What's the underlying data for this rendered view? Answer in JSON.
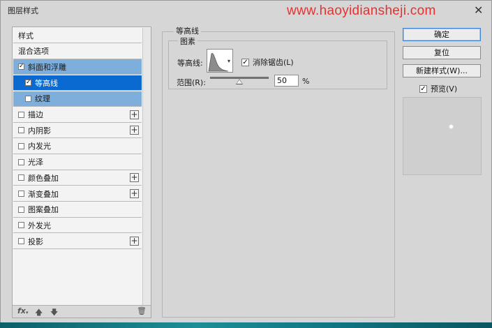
{
  "window": {
    "title": "图层样式",
    "watermark": "www.haoyidiansheji.com"
  },
  "style_list": {
    "items": [
      {
        "label": "样式",
        "checkbox": false,
        "checked": false,
        "plus": false
      },
      {
        "label": "混合选项",
        "checkbox": false,
        "checked": false,
        "plus": false
      },
      {
        "label": "斜面和浮雕",
        "checkbox": true,
        "checked": true,
        "plus": false
      },
      {
        "label": "等高线",
        "checkbox": true,
        "checked": true,
        "plus": false
      },
      {
        "label": "纹理",
        "checkbox": true,
        "checked": false,
        "plus": false
      },
      {
        "label": "描边",
        "checkbox": true,
        "checked": false,
        "plus": true
      },
      {
        "label": "内阴影",
        "checkbox": true,
        "checked": false,
        "plus": true
      },
      {
        "label": "内发光",
        "checkbox": true,
        "checked": false,
        "plus": false
      },
      {
        "label": "光泽",
        "checkbox": true,
        "checked": false,
        "plus": false
      },
      {
        "label": "颜色叠加",
        "checkbox": true,
        "checked": false,
        "plus": true
      },
      {
        "label": "渐变叠加",
        "checkbox": true,
        "checked": false,
        "plus": true
      },
      {
        "label": "图案叠加",
        "checkbox": true,
        "checked": false,
        "plus": false
      },
      {
        "label": "外发光",
        "checkbox": true,
        "checked": false,
        "plus": false
      },
      {
        "label": "投影",
        "checkbox": true,
        "checked": false,
        "plus": true
      }
    ],
    "footer": {
      "fx": "fx"
    }
  },
  "contour_panel": {
    "group_title": "等高线",
    "sub_title": "图素",
    "contour_label": "等高线:",
    "anti_alias_label": "消除锯齿(L)",
    "anti_alias_checked": true,
    "range_label": "范围(R):",
    "range_value": "50",
    "range_unit": "%"
  },
  "buttons": {
    "ok": "确定",
    "reset": "复位",
    "new_style": "新建样式(W)...",
    "preview_label": "预览(V)",
    "preview_checked": true
  }
}
